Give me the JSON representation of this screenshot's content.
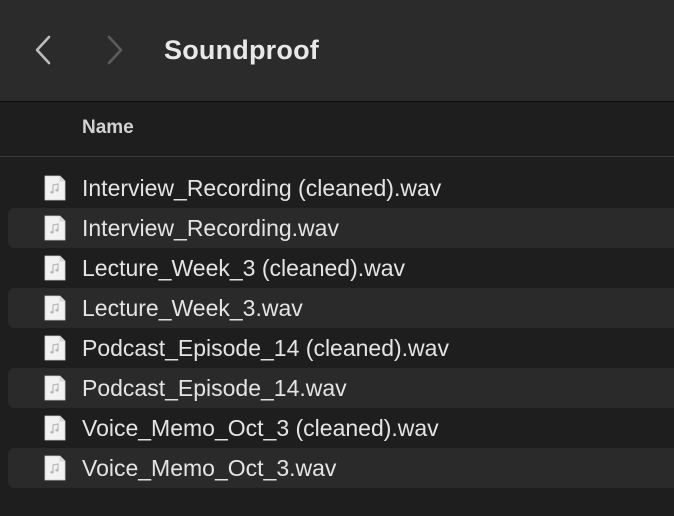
{
  "toolbar": {
    "back_icon": "chevron-left-icon",
    "forward_icon": "chevron-right-icon",
    "title": "Soundproof"
  },
  "list_header": {
    "name_label": "Name"
  },
  "files": [
    {
      "name": "Interview_Recording (cleaned).wav",
      "icon": "audio-file-icon"
    },
    {
      "name": "Interview_Recording.wav",
      "icon": "audio-file-icon"
    },
    {
      "name": "Lecture_Week_3 (cleaned).wav",
      "icon": "audio-file-icon"
    },
    {
      "name": "Lecture_Week_3.wav",
      "icon": "audio-file-icon"
    },
    {
      "name": "Podcast_Episode_14 (cleaned).wav",
      "icon": "audio-file-icon"
    },
    {
      "name": "Podcast_Episode_14.wav",
      "icon": "audio-file-icon"
    },
    {
      "name": "Voice_Memo_Oct_3 (cleaned).wav",
      "icon": "audio-file-icon"
    },
    {
      "name": "Voice_Memo_Oct_3.wav",
      "icon": "audio-file-icon"
    }
  ],
  "colors": {
    "toolbar_bg": "#2b2b2b",
    "list_bg": "#1e1e1e",
    "alt_row_bg": "#2a2a2a",
    "text": "#e4e4e4"
  }
}
